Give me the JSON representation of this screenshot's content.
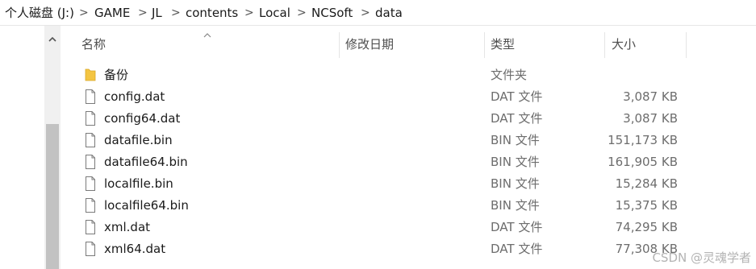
{
  "breadcrumb": [
    "个人磁盘 (J:)",
    "GAME",
    "JL",
    "contents",
    "Local",
    "NCSoft",
    "data"
  ],
  "columns": {
    "name": "名称",
    "date_modified": "修改日期",
    "type": "类型",
    "size": "大小"
  },
  "files": [
    {
      "name": "备份",
      "type": "文件夹",
      "size": "",
      "icon": "folder-icon"
    },
    {
      "name": "config.dat",
      "type": "DAT 文件",
      "size": "3,087 KB",
      "icon": "file-icon"
    },
    {
      "name": "config64.dat",
      "type": "DAT 文件",
      "size": "3,087 KB",
      "icon": "file-icon"
    },
    {
      "name": "datafile.bin",
      "type": "BIN 文件",
      "size": "151,173 KB",
      "icon": "file-icon"
    },
    {
      "name": "datafile64.bin",
      "type": "BIN 文件",
      "size": "161,905 KB",
      "icon": "file-icon"
    },
    {
      "name": "localfile.bin",
      "type": "BIN 文件",
      "size": "15,284 KB",
      "icon": "file-icon"
    },
    {
      "name": "localfile64.bin",
      "type": "BIN 文件",
      "size": "15,375 KB",
      "icon": "file-icon"
    },
    {
      "name": "xml.dat",
      "type": "DAT 文件",
      "size": "74,295 KB",
      "icon": "file-icon"
    },
    {
      "name": "xml64.dat",
      "type": "DAT 文件",
      "size": "77,308 KB",
      "icon": "file-icon"
    }
  ],
  "watermark": "CSDN @灵魂学者",
  "colors": {
    "folder": "#f4c542",
    "scroll_thumb": "#c2c2c2",
    "accent": "#0078d7"
  }
}
